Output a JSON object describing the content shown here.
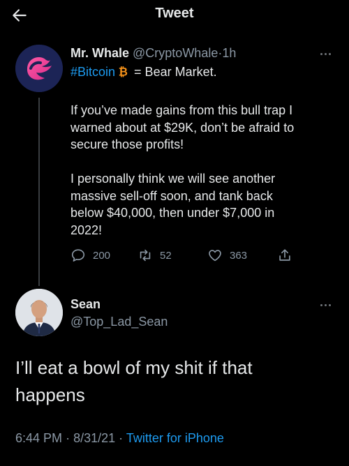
{
  "header": {
    "title": "Tweet"
  },
  "tweet": {
    "author_name": "Mr. Whale",
    "author_handle": "@CryptoWhale",
    "separator": "·",
    "time": "1h",
    "hashtag": "#Bitcoin",
    "headline_rest": " = Bear Market.",
    "paragraph1": [
      "If you’ve made gains from this bull trap I",
      "warned about at $29K, don’t be afraid to",
      "secure those profits!"
    ],
    "paragraph2": [
      "I personally think we will see another",
      "massive sell-off soon, and tank back",
      "below $40,000, then under $7,000 in",
      "2022!"
    ],
    "replies": "200",
    "retweets": "52",
    "likes": "363"
  },
  "reply": {
    "author_name": "Sean",
    "author_handle": "@Top_Lad_Sean",
    "text_lines": [
      "I’ll eat a bowl of my shit if that",
      "happens"
    ],
    "time": "6:44 PM",
    "date": "8/31/21",
    "separator": "·",
    "source": "Twitter for iPhone"
  },
  "icons": {
    "back": "arrow-left-icon",
    "reply": "speech-bubble-icon",
    "retweet": "retweet-icon",
    "like": "heart-icon",
    "share": "share-icon",
    "more": "more-icon",
    "bitcoin": "bitcoin-emoji"
  },
  "colors": {
    "background": "#000000",
    "text": "#e7e9ea",
    "secondary": "#8b98a5",
    "accent": "#1d9bf0",
    "bitcoin": "#f7931a"
  }
}
